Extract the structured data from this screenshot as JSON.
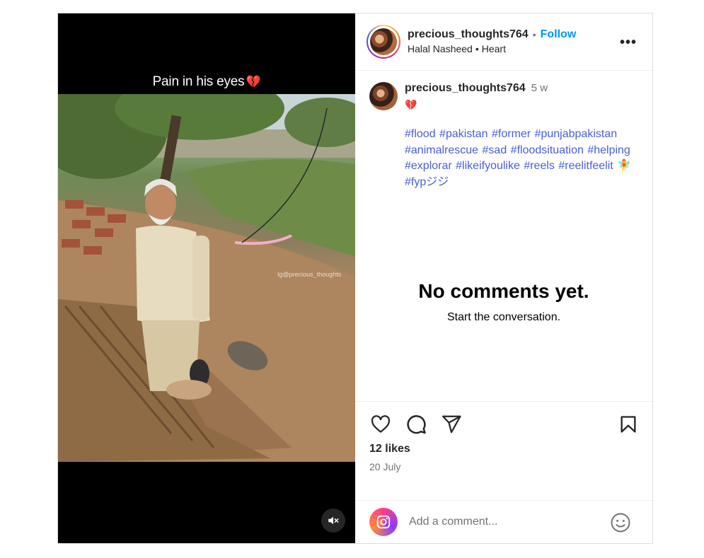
{
  "media": {
    "overlay_text": "Pain in his eyes",
    "overlay_emoji": "💔",
    "watermark": "Ig@precious_thoughts",
    "mute_icon": "speaker-muted-icon"
  },
  "header": {
    "username": "precious_thoughts764",
    "separator": "•",
    "follow_label": "Follow",
    "audio_artist": "Halal Nasheed",
    "audio_separator": "•",
    "audio_track": "Heart",
    "more_label": "•••"
  },
  "caption": {
    "username": "precious_thoughts764",
    "time": "5 w",
    "emoji": "💔",
    "hashtags": [
      "#flood",
      "#pakistan",
      "#former",
      "#punjabpakistan",
      "#animalrescue",
      "#sad",
      "#floodsituation",
      "#helping",
      "#explorar",
      "#likeifyoulike",
      "#reels",
      "#reelitfeelit",
      "🧚",
      "#fypジジ"
    ]
  },
  "empty_state": {
    "title": "No comments yet.",
    "subtitle": "Start the conversation."
  },
  "actions": {
    "like_icon": "heart-icon",
    "comment_icon": "comment-icon",
    "share_icon": "send-icon",
    "save_icon": "bookmark-icon",
    "likes": "12 likes",
    "date": "20 July"
  },
  "comment_box": {
    "placeholder": "Add a comment...",
    "emoji_icon": "smiley-icon"
  },
  "colors": {
    "accent": "#0095f6",
    "hashtag": "#4a5fd1",
    "muted": "#737373",
    "border": "#dbdbdb"
  }
}
